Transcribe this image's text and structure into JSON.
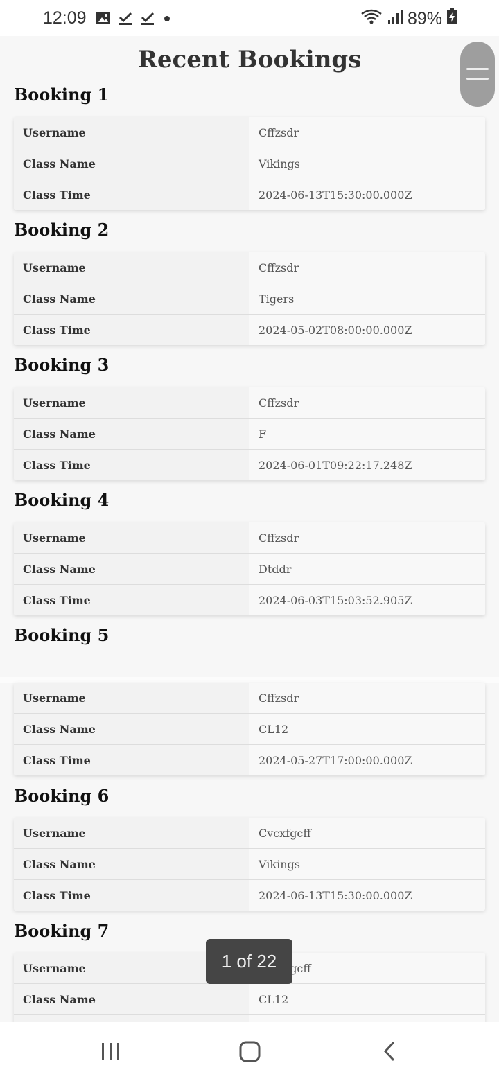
{
  "status_bar": {
    "time": "12:09",
    "battery": "89%",
    "icons": [
      "image-icon",
      "check-icon",
      "check-icon",
      "dot-icon",
      "wifi-icon",
      "signal-icon",
      "battery-charging-icon"
    ]
  },
  "page": {
    "title": "Recent Bookings"
  },
  "labels": {
    "username": "Username",
    "class_name": "Class Name",
    "class_time": "Class Time"
  },
  "bookings": [
    {
      "heading": "Booking 1",
      "username": "Cffzsdr",
      "class_name": "Vikings",
      "class_time": "2024-06-13T15:30:00.000Z"
    },
    {
      "heading": "Booking 2",
      "username": "Cffzsdr",
      "class_name": "Tigers",
      "class_time": "2024-05-02T08:00:00.000Z"
    },
    {
      "heading": "Booking 3",
      "username": "Cffzsdr",
      "class_name": "F",
      "class_time": "2024-06-01T09:22:17.248Z"
    },
    {
      "heading": "Booking 4",
      "username": "Cffzsdr",
      "class_name": "Dtddr",
      "class_time": "2024-06-03T15:03:52.905Z"
    },
    {
      "heading": "Booking 5",
      "username": "Cffzsdr",
      "class_name": "CL12",
      "class_time": "2024-05-27T17:00:00.000Z"
    },
    {
      "heading": "Booking 6",
      "username": "Cvcxfgcff",
      "class_name": "Vikings",
      "class_time": "2024-06-13T15:30:00.000Z"
    },
    {
      "heading": "Booking 7",
      "username": "Cvcxfgcff",
      "class_name": "CL12",
      "class_time": ""
    }
  ],
  "toast": {
    "text": "1 of 22"
  },
  "colors": {
    "background": "#f7f7f7",
    "menu_button": "#9e9e9e",
    "toast": "#454545"
  }
}
